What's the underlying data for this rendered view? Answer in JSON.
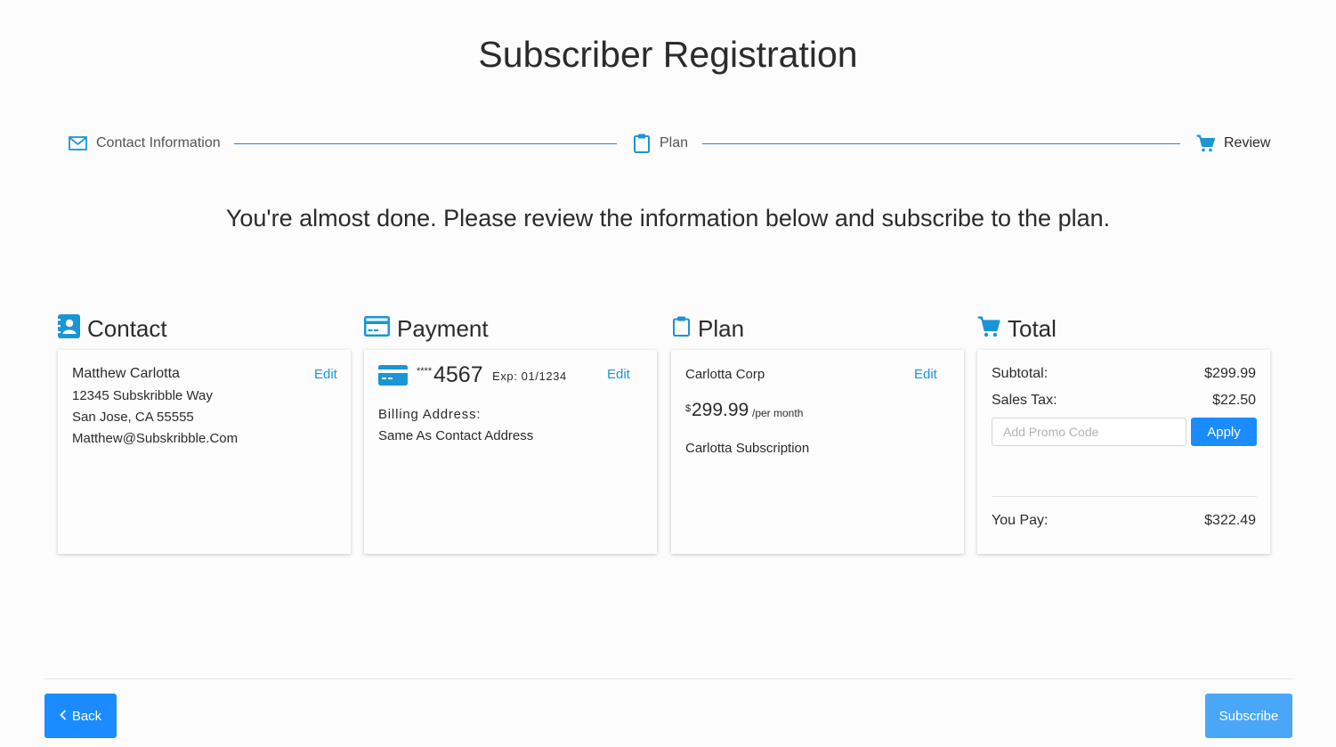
{
  "page": {
    "title": "Subscriber Registration",
    "intro": "You're almost done. Please review the information below and subscribe to the plan."
  },
  "stepper": {
    "steps": [
      {
        "label": "Contact Information",
        "icon": "envelope-icon"
      },
      {
        "label": "Plan",
        "icon": "clipboard-icon"
      },
      {
        "label": "Review",
        "icon": "cart-icon"
      }
    ],
    "line_color": "#2f86c8"
  },
  "contact": {
    "heading": "Contact",
    "edit": "Edit",
    "name": "Matthew Carlotta",
    "street": "12345 Subskribble Way",
    "city": "San Jose, CA 55555",
    "email": "Matthew@Subskribble.Com"
  },
  "payment": {
    "heading": "Payment",
    "edit": "Edit",
    "mask": "****",
    "last4": "4567",
    "exp": "Exp: 01/1234",
    "billing_label": "Billing Address:",
    "billing_value": "Same As Contact Address"
  },
  "plan": {
    "heading": "Plan",
    "edit": "Edit",
    "company": "Carlotta Corp",
    "currency": "$",
    "price": "299.99",
    "period": "/per month",
    "name": "Carlotta Subscription"
  },
  "total": {
    "heading": "Total",
    "subtotal_label": "Subtotal:",
    "subtotal_value": "$299.99",
    "tax_label": "Sales Tax:",
    "tax_value": "$22.50",
    "promo_placeholder": "Add Promo Code",
    "promo_value": "",
    "apply": "Apply",
    "pay_label": "You Pay:",
    "pay_value": "$322.49"
  },
  "footer": {
    "back": "Back",
    "subscribe": "Subscribe"
  },
  "colors": {
    "accent": "#1a8cff",
    "icon_blue": "#1a95d6",
    "subscribe_bg": "#4aa7f7"
  }
}
